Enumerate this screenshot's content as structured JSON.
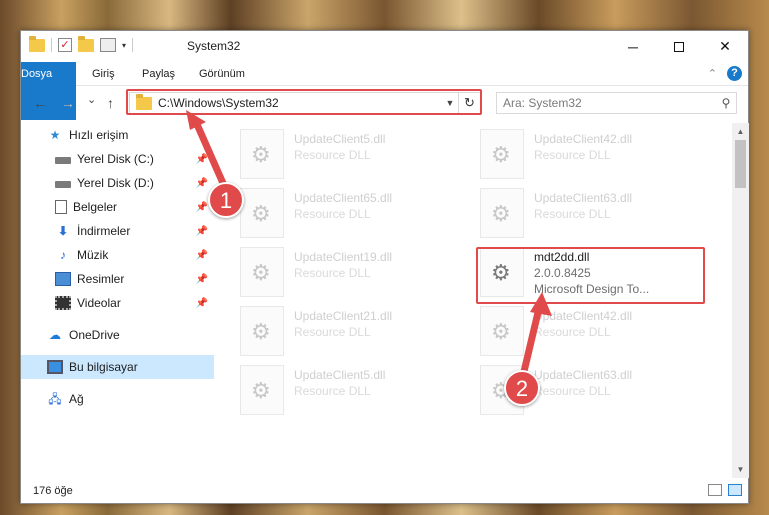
{
  "window": {
    "title": "System32",
    "controls": {
      "minimize": "─",
      "close": "✕"
    }
  },
  "ribbon": {
    "tabs": [
      "Dosya",
      "Giriş",
      "Paylaş",
      "Görünüm"
    ],
    "help": "?"
  },
  "nav": {
    "back": "←",
    "forward": "→",
    "recent": "⌄",
    "up": "↑",
    "address": "C:\\Windows\\System32",
    "search_placeholder": "Ara: System32"
  },
  "sidebar": {
    "items": [
      {
        "label": "Hızlı erişim",
        "icon": "star-icon",
        "pinned": false
      },
      {
        "label": "Yerel Disk (C:)",
        "icon": "drive-icon",
        "pinned": true
      },
      {
        "label": "Yerel Disk (D:)",
        "icon": "drive-icon",
        "pinned": true
      },
      {
        "label": "Belgeler",
        "icon": "documents-icon",
        "pinned": true
      },
      {
        "label": "İndirmeler",
        "icon": "download-icon",
        "pinned": true
      },
      {
        "label": "Müzik",
        "icon": "music-icon",
        "pinned": true
      },
      {
        "label": "Resimler",
        "icon": "pictures-icon",
        "pinned": true
      },
      {
        "label": "Videolar",
        "icon": "videos-icon",
        "pinned": true
      },
      {
        "label": "OneDrive",
        "icon": "onedrive-icon",
        "pinned": false
      },
      {
        "label": "Bu bilgisayar",
        "icon": "this-pc-icon",
        "pinned": false,
        "selected": true
      },
      {
        "label": "Ağ",
        "icon": "network-icon",
        "pinned": false
      }
    ]
  },
  "files": [
    {
      "name": "UpdateClient5.dll",
      "sub": "Resource DLL"
    },
    {
      "name": "UpdateClient42.dll",
      "sub": "Resource DLL"
    },
    {
      "name": "UpdateClient65.dll",
      "sub": "Resource DLL"
    },
    {
      "name": "UpdateClient63.dll",
      "sub": "Resource DLL"
    },
    {
      "name": "UpdateClient19.dll",
      "sub": "Resource DLL"
    },
    {
      "name": "mdt2dd.dll",
      "sub": "2.0.0.8425",
      "sub2": "Microsoft Design To...",
      "active": true
    },
    {
      "name": "UpdateClient21.dll",
      "sub": "Resource DLL"
    },
    {
      "name": "UpdateClient42.dll",
      "sub": "Resource DLL"
    },
    {
      "name": "UpdateClient5.dll",
      "sub": "Resource DLL"
    },
    {
      "name": "UpdateClient63.dll",
      "sub": "Resource DLL"
    }
  ],
  "status": {
    "count": "176 öğe"
  },
  "annotations": {
    "step1": "1",
    "step2": "2",
    "color": "#e04a4a"
  }
}
